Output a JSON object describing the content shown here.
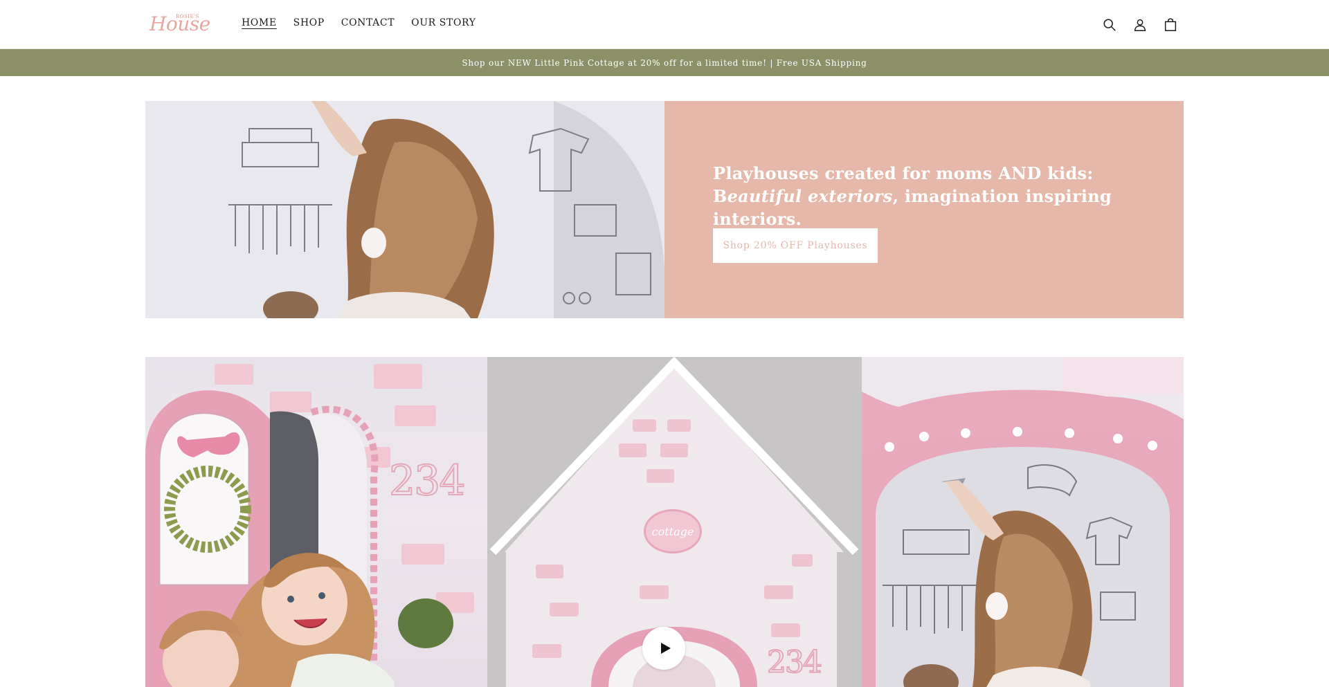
{
  "header": {
    "logo_small": "ROSIE'S",
    "logo_big": "House",
    "nav": [
      {
        "label": "HOME",
        "active": true
      },
      {
        "label": "SHOP",
        "active": false
      },
      {
        "label": "CONTACT",
        "active": false
      },
      {
        "label": "OUR STORY",
        "active": false
      }
    ],
    "icons": [
      "search-icon",
      "account-icon",
      "cart-icon"
    ]
  },
  "announcement": {
    "text": "Shop our NEW Little Pink Cottage at 20% off for a limited time! | Free USA Shipping",
    "bg_color": "#8b9068"
  },
  "hero": {
    "heading_plain": "Playhouses created for moms AND kids: B",
    "heading_italic": "eautiful exteriors",
    "heading_end": ", imagination inspiring interiors.",
    "button_label": "Shop 20% OFF Playhouses",
    "panel_color": "#e6b8a9"
  },
  "gallery": {
    "tile_1_number": "234",
    "tile_2_sign": "cottage",
    "tile_2_number": "234",
    "video_control": "play-icon"
  }
}
